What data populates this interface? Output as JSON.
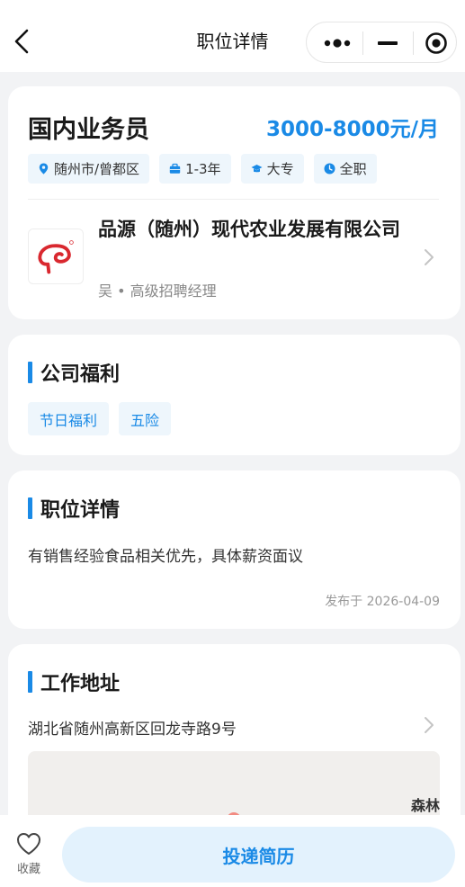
{
  "nav": {
    "title": "职位详情"
  },
  "job": {
    "title": "国内业务员",
    "salary": "3000-8000元/月",
    "tags": [
      {
        "icon": "location-pin-icon",
        "label": "随州市/曾都区"
      },
      {
        "icon": "briefcase-icon",
        "label": "1-3年"
      },
      {
        "icon": "graduation-cap-icon",
        "label": "大专"
      },
      {
        "icon": "clock-icon",
        "label": "全职"
      }
    ],
    "company": {
      "name": "品源（随州）现代农业发展有限公司",
      "recruiter": "吴 • 高级招聘经理"
    }
  },
  "benefits": {
    "title": "公司福利",
    "items": [
      "节日福利",
      "五险"
    ]
  },
  "detail": {
    "title": "职位详情",
    "description": "有销售经验食品相关优先，具体薪资面议",
    "published": "发布于 2026-04-09"
  },
  "address": {
    "title": "工作地址",
    "text": "湖北省随州高新区回龙寺路9号",
    "map_label": "森林"
  },
  "bottom": {
    "favorite_label": "收藏",
    "apply_label": "投递简历"
  },
  "colors": {
    "accent": "#1a8ae6",
    "tag_bg": "#eef6fc",
    "apply_bg": "#e3f2fd",
    "logo_red": "#d9282f"
  }
}
